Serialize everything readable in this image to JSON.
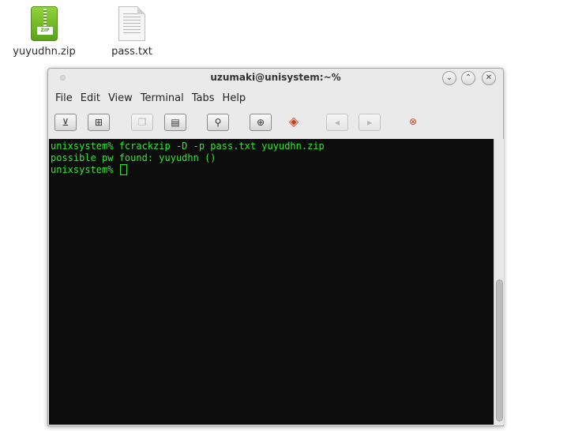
{
  "desktop": {
    "icons": [
      {
        "label": "yuyudhn.zip",
        "icon": "zip-archive-icon",
        "color": "#6ab82a"
      },
      {
        "label": "pass.txt",
        "icon": "text-file-icon"
      }
    ]
  },
  "window": {
    "title": "uzumaki@unisystem:~%",
    "controls": {
      "minimize": "⌄",
      "maximize": "⌃",
      "close": "✕"
    }
  },
  "menubar": {
    "items": [
      {
        "label": "File"
      },
      {
        "label": "Edit"
      },
      {
        "label": "View"
      },
      {
        "label": "Terminal"
      },
      {
        "label": "Tabs"
      },
      {
        "label": "Help"
      }
    ]
  },
  "toolbar": {
    "buttons": [
      {
        "icon": "new-tab-icon",
        "glyph": "⊻",
        "enabled": true
      },
      {
        "icon": "new-window-icon",
        "glyph": "⊞",
        "enabled": true
      },
      {
        "icon": "copy-icon",
        "glyph": "❐",
        "enabled": false
      },
      {
        "icon": "paste-icon",
        "glyph": "▤",
        "enabled": true
      },
      {
        "icon": "search-icon",
        "glyph": "⚲",
        "enabled": true
      },
      {
        "icon": "fullscreen-icon",
        "glyph": "⊕",
        "enabled": true
      },
      {
        "icon": "preferences-icon",
        "glyph": "◈",
        "enabled": true
      },
      {
        "icon": "back-arrow-icon",
        "glyph": "◂",
        "enabled": false
      },
      {
        "icon": "forward-arrow-icon",
        "glyph": "▸",
        "enabled": false
      },
      {
        "icon": "help-icon",
        "glyph": "⊗",
        "enabled": true
      }
    ]
  },
  "terminal": {
    "lines": [
      "unixsystem% fcrackzip -D -p pass.txt yuyudhn.zip",
      "possible pw found: yuyudhn ()",
      "unixsystem% "
    ],
    "text_color": "#2fea2f",
    "background": "#0c0c0c"
  }
}
